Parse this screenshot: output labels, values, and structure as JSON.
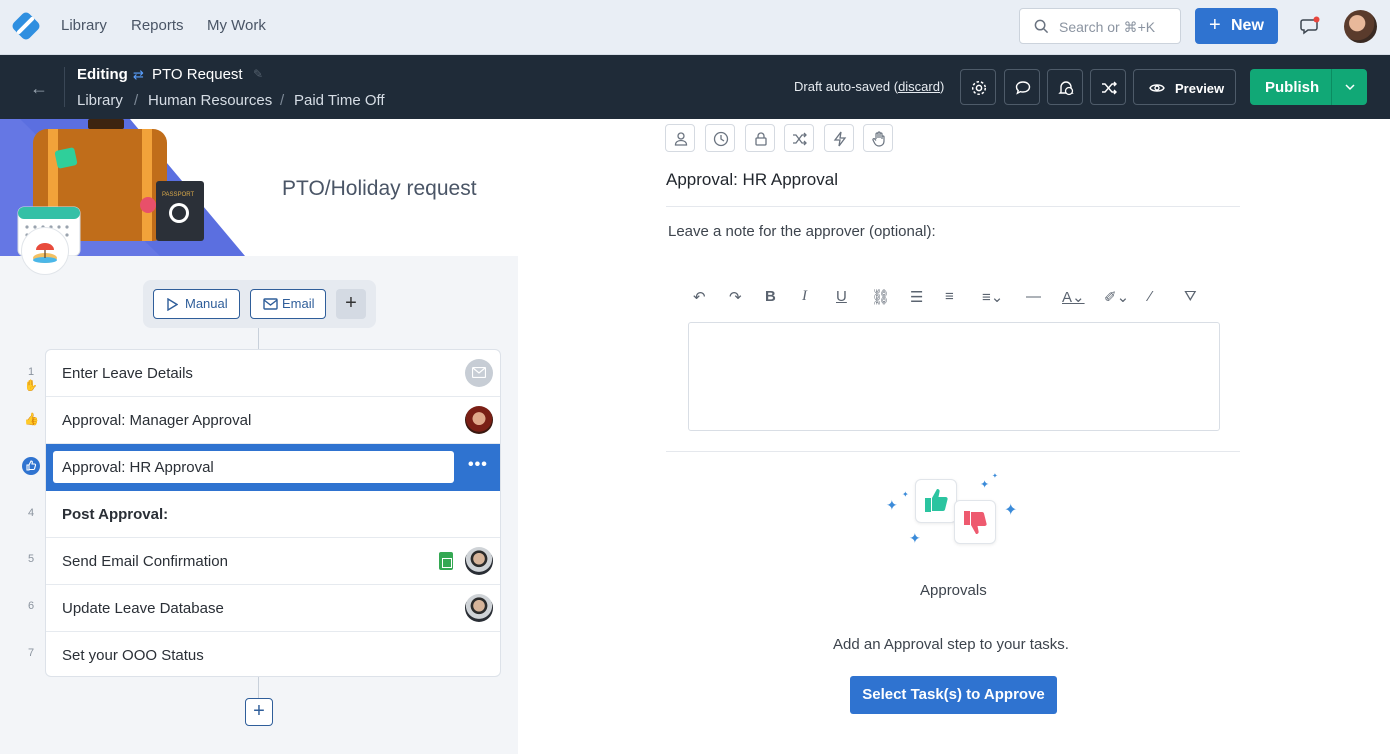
{
  "topnav": {
    "links": [
      "Library",
      "Reports",
      "My Work"
    ],
    "search_placeholder": "Search or ⌘+K",
    "new_label": "New"
  },
  "editor_bar": {
    "mode": "Editing",
    "workflow_title": "PTO Request",
    "breadcrumb": [
      "Library",
      "Human Resources",
      "Paid Time Off"
    ],
    "draft_text": "Draft auto-saved",
    "discard_label": "discard",
    "preview_label": "Preview",
    "publish_label": "Publish"
  },
  "workflow": {
    "title": "PTO/Holiday request",
    "triggers": [
      "Manual",
      "Email"
    ],
    "tasks": [
      {
        "num": "1",
        "label": "Enter Leave Details"
      },
      {
        "num": "",
        "label": "Approval: Manager Approval"
      },
      {
        "num": "",
        "label": "Approval: HR Approval"
      },
      {
        "num": "4",
        "label": "Post Approval:"
      },
      {
        "num": "5",
        "label": "Send Email Confirmation"
      },
      {
        "num": "6",
        "label": "Update Leave Database"
      },
      {
        "num": "7",
        "label": "Set your OOO Status"
      }
    ]
  },
  "task_detail": {
    "title": "Approval: HR Approval",
    "note_label": "Leave a note for the approver (optional):",
    "approvals_label": "Approvals",
    "approvals_desc": "Add an Approval step to your tasks.",
    "select_button": "Select Task(s) to Approve"
  },
  "colors": {
    "primary": "#2f73d0",
    "publish": "#11a876",
    "dark_bar": "#1f2b38"
  }
}
